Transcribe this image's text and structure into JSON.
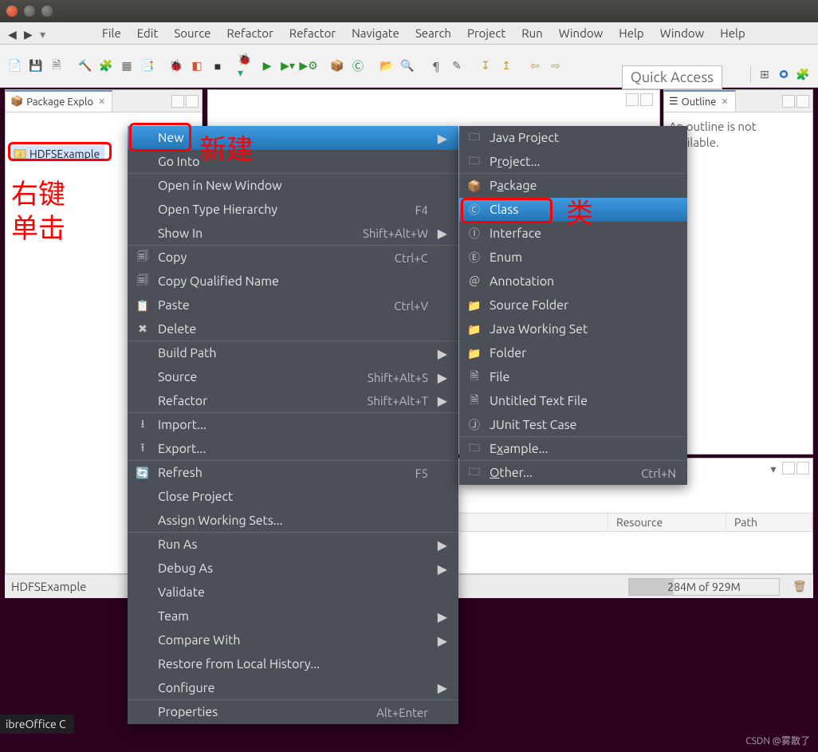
{
  "menubar": {
    "items": [
      "File",
      "Edit",
      "Source",
      "Refactor",
      "Refactor",
      "Navigate",
      "Search",
      "Project",
      "Run",
      "Window",
      "Help",
      "Window",
      "Help"
    ]
  },
  "quick_access": "Quick Access",
  "views": {
    "package_explorer": {
      "title": "Package Explo",
      "project": "HDFSExample"
    },
    "outline": {
      "title": "Outline",
      "message": "An outline is not available."
    }
  },
  "problems": {
    "columns": [
      "Resource",
      "Path"
    ]
  },
  "status": {
    "project": "HDFSExample",
    "heap": "284M of 929M"
  },
  "context_menu": {
    "items": [
      {
        "label": "New",
        "submenu": true,
        "hover": true
      },
      {
        "label": "Go Into"
      },
      {
        "label": "Open in New Window"
      },
      {
        "label": "Open Type Hierarchy",
        "accel": "F4"
      },
      {
        "label": "Show In",
        "accel": "Shift+Alt+W",
        "submenu": true
      },
      {
        "label": "Copy",
        "accel": "Ctrl+C",
        "icon": "copy"
      },
      {
        "label": "Copy Qualified Name",
        "icon": "copy"
      },
      {
        "label": "Paste",
        "accel": "Ctrl+V",
        "icon": "paste"
      },
      {
        "label": "Delete",
        "icon": "delete"
      },
      {
        "label": "Build Path",
        "submenu": true
      },
      {
        "label": "Source",
        "accel": "Shift+Alt+S",
        "submenu": true
      },
      {
        "label": "Refactor",
        "accel": "Shift+Alt+T",
        "submenu": true
      },
      {
        "label": "Import...",
        "icon": "import"
      },
      {
        "label": "Export...",
        "icon": "export"
      },
      {
        "label": "Refresh",
        "accel": "F5",
        "icon": "refresh"
      },
      {
        "label": "Close Project"
      },
      {
        "label": "Assign Working Sets..."
      },
      {
        "label": "Run As",
        "submenu": true
      },
      {
        "label": "Debug As",
        "submenu": true
      },
      {
        "label": "Validate"
      },
      {
        "label": "Team",
        "submenu": true
      },
      {
        "label": "Compare With",
        "submenu": true
      },
      {
        "label": "Restore from Local History..."
      },
      {
        "label": "Configure",
        "submenu": true
      },
      {
        "label": "Properties",
        "accel": "Alt+Enter"
      }
    ],
    "new_submenu": [
      {
        "label": "Java Project",
        "icon": "java-project"
      },
      {
        "underlined": "r",
        "pre": "P",
        "post": "oject...",
        "icon": "project"
      },
      {
        "underlined": "a",
        "pre": "P",
        "post": "ckage",
        "icon": "package"
      },
      {
        "label": "Class",
        "hover": true,
        "icon": "class"
      },
      {
        "label": "Interface",
        "icon": "interface"
      },
      {
        "label": "Enum",
        "icon": "enum"
      },
      {
        "label": "Annotation",
        "icon": "annotation"
      },
      {
        "label": "Source Folder",
        "icon": "src-folder"
      },
      {
        "label": "Java Working Set",
        "icon": "working-set"
      },
      {
        "label": "Folder",
        "icon": "folder"
      },
      {
        "label": "File",
        "icon": "file"
      },
      {
        "label": "Untitled Text File",
        "icon": "text-file"
      },
      {
        "label": "JUnit Test Case",
        "icon": "junit"
      },
      {
        "underlined": "x",
        "pre": "E",
        "post": "ample...",
        "icon": "example"
      },
      {
        "underlined": "O",
        "pre": "",
        "post": "ther...",
        "accel": "Ctrl+N",
        "icon": "other"
      }
    ]
  },
  "annotations": {
    "new_label": "新建",
    "class_label": "类",
    "right_click": "右键\n单击"
  },
  "taskbar": {
    "chip": "ibreOffice C"
  },
  "watermark": "CSDN @雾散了"
}
